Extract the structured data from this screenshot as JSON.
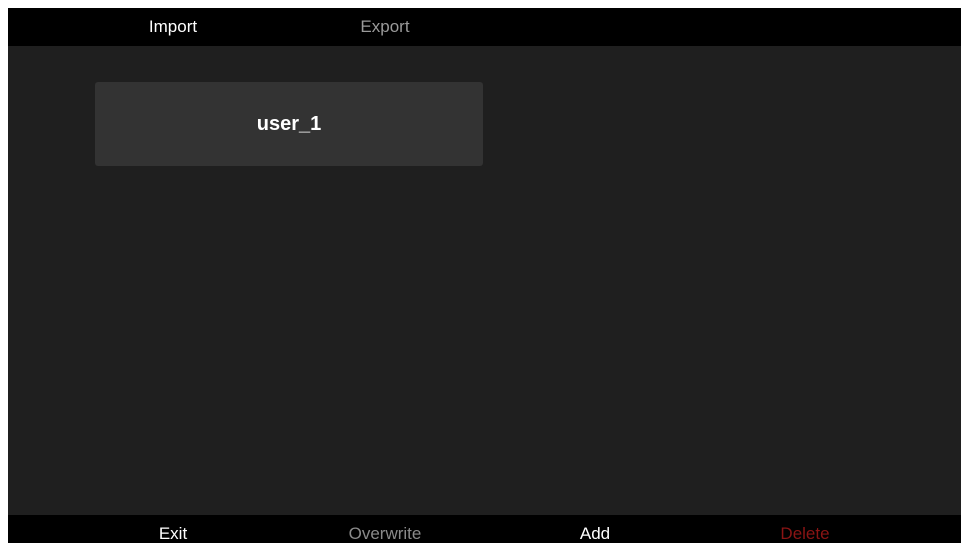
{
  "top_tabs": {
    "import": "Import",
    "export": "Export"
  },
  "users": [
    {
      "name": "user_1"
    }
  ],
  "actions": {
    "exit": "Exit",
    "overwrite": "Overwrite",
    "add": "Add",
    "delete": "Delete"
  },
  "colors": {
    "background": "#1f1f1f",
    "bar": "#000000",
    "card": "#333333",
    "active_text": "#ffffff",
    "inactive_text": "#9a9a9a",
    "delete_text": "#8a1414"
  }
}
